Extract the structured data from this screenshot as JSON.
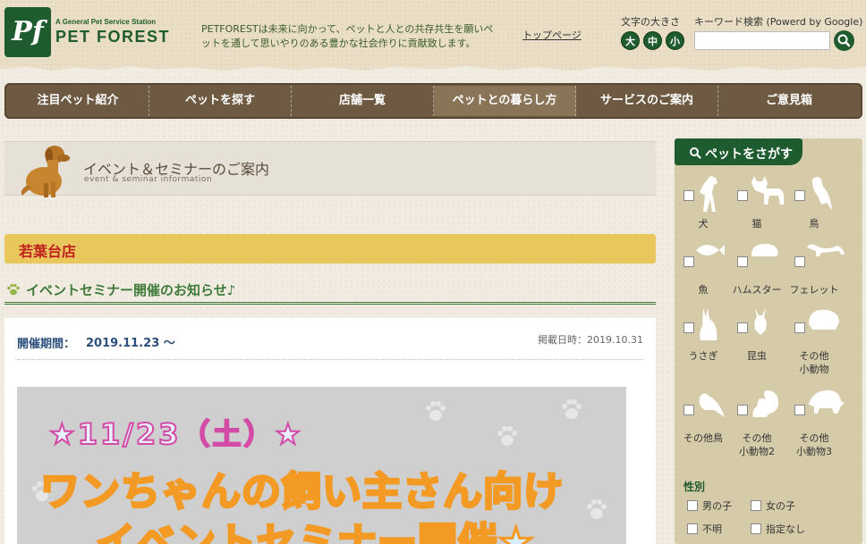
{
  "header": {
    "logo_mark": "Pf",
    "logo_tagline": "A General Pet Service Station",
    "logo_name": "PET FOREST",
    "tagline": "PETFORESTは未来に向かって、ペットと人との共存共生を願いペットを通して思いやりのある豊かな社会作りに貢献致します。",
    "top_link": "トップページ",
    "font_size_label": "文字の大きさ",
    "font_sizes": [
      "大",
      "中",
      "小"
    ],
    "search_label": "キーワード検索 (Powerd by Google)",
    "search_placeholder": ""
  },
  "nav": {
    "items": [
      "注目ペット紹介",
      "ペットを探す",
      "店舗一覧",
      "ペットとの暮らし方",
      "サービスのご案内",
      "ご意見箱"
    ],
    "active_index": 3
  },
  "page_title": {
    "jp": "イベント＆セミナーのご案内",
    "en": "event & seminar information"
  },
  "store": {
    "name": "若葉台店"
  },
  "section": {
    "title": "イベントセミナー開催のお知らせ♪"
  },
  "article": {
    "period_label": "開催期間：",
    "period_value": "2019.11.23 ～",
    "posted": "掲載日時：2019.10.31",
    "banner_date": "★11/23（土）★",
    "banner_line1": "ワンちゃんの飼い主さん向け",
    "banner_line2": "イベントセミナー開催★"
  },
  "sidebar": {
    "title": "ペットをさがす",
    "pets": [
      {
        "label": "犬",
        "icon": "dog-icon"
      },
      {
        "label": "猫",
        "icon": "cat-icon"
      },
      {
        "label": "鳥",
        "icon": "bird-icon"
      },
      {
        "label": "魚",
        "icon": "fish-icon"
      },
      {
        "label": "ハムスター",
        "icon": "hamster-icon"
      },
      {
        "label": "フェレット",
        "icon": "ferret-icon"
      },
      {
        "label": "うさぎ",
        "icon": "rabbit-icon"
      },
      {
        "label": "昆虫",
        "icon": "insect-icon"
      },
      {
        "label": "その他\n小動物",
        "icon": "small-animal-icon"
      },
      {
        "label": "その他鳥",
        "icon": "other-bird-icon"
      },
      {
        "label": "その他\n小動物2",
        "icon": "squirrel-icon"
      },
      {
        "label": "その他\n小動物3",
        "icon": "turtle-icon"
      }
    ],
    "gender_title": "性別",
    "gender_options": [
      "男の子",
      "女の子",
      "不明",
      "指定なし"
    ]
  },
  "colors": {
    "brand_green": "#1e5b2e",
    "nav_brown": "#6e5a42",
    "store_yellow": "#e9c75c",
    "store_red": "#c0201e",
    "section_green": "#3f7a3a"
  }
}
